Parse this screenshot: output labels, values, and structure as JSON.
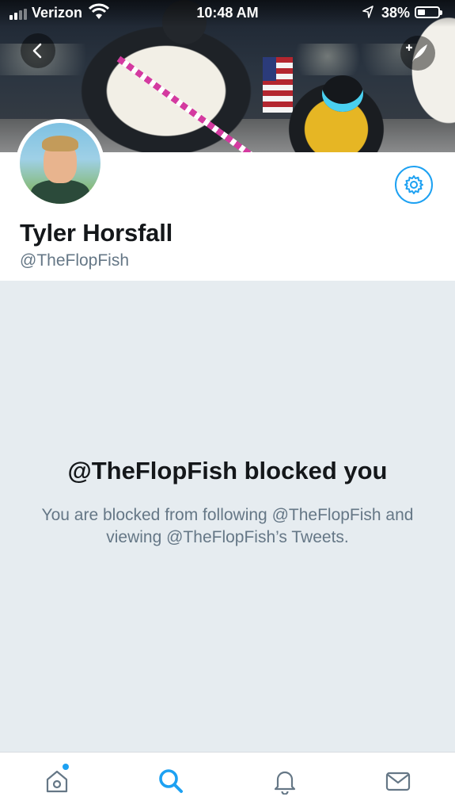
{
  "status_bar": {
    "carrier": "Verizon",
    "time": "10:48 AM",
    "battery_percent": "38%",
    "battery_level": 0.38
  },
  "header": {
    "back_icon": "chevron-left-icon",
    "compose_icon": "compose-tweet-icon",
    "settings_icon": "gear-icon"
  },
  "profile": {
    "display_name": "Tyler Horsfall",
    "handle": "@TheFlopFish"
  },
  "blocked": {
    "title": "@TheFlopFish blocked you",
    "description": "You are blocked from following @TheFlopFish and viewing @TheFlopFish’s Tweets."
  },
  "tab_bar": {
    "items": [
      {
        "icon": "home-icon",
        "active": false,
        "has_badge": true
      },
      {
        "icon": "search-icon",
        "active": true,
        "has_badge": false
      },
      {
        "icon": "bell-icon",
        "active": false,
        "has_badge": false
      },
      {
        "icon": "mail-icon",
        "active": false,
        "has_badge": false
      }
    ]
  },
  "colors": {
    "accent": "#1da1f2",
    "text_primary": "#14171a",
    "text_secondary": "#657786",
    "blocked_bg": "#e6ecf0"
  }
}
